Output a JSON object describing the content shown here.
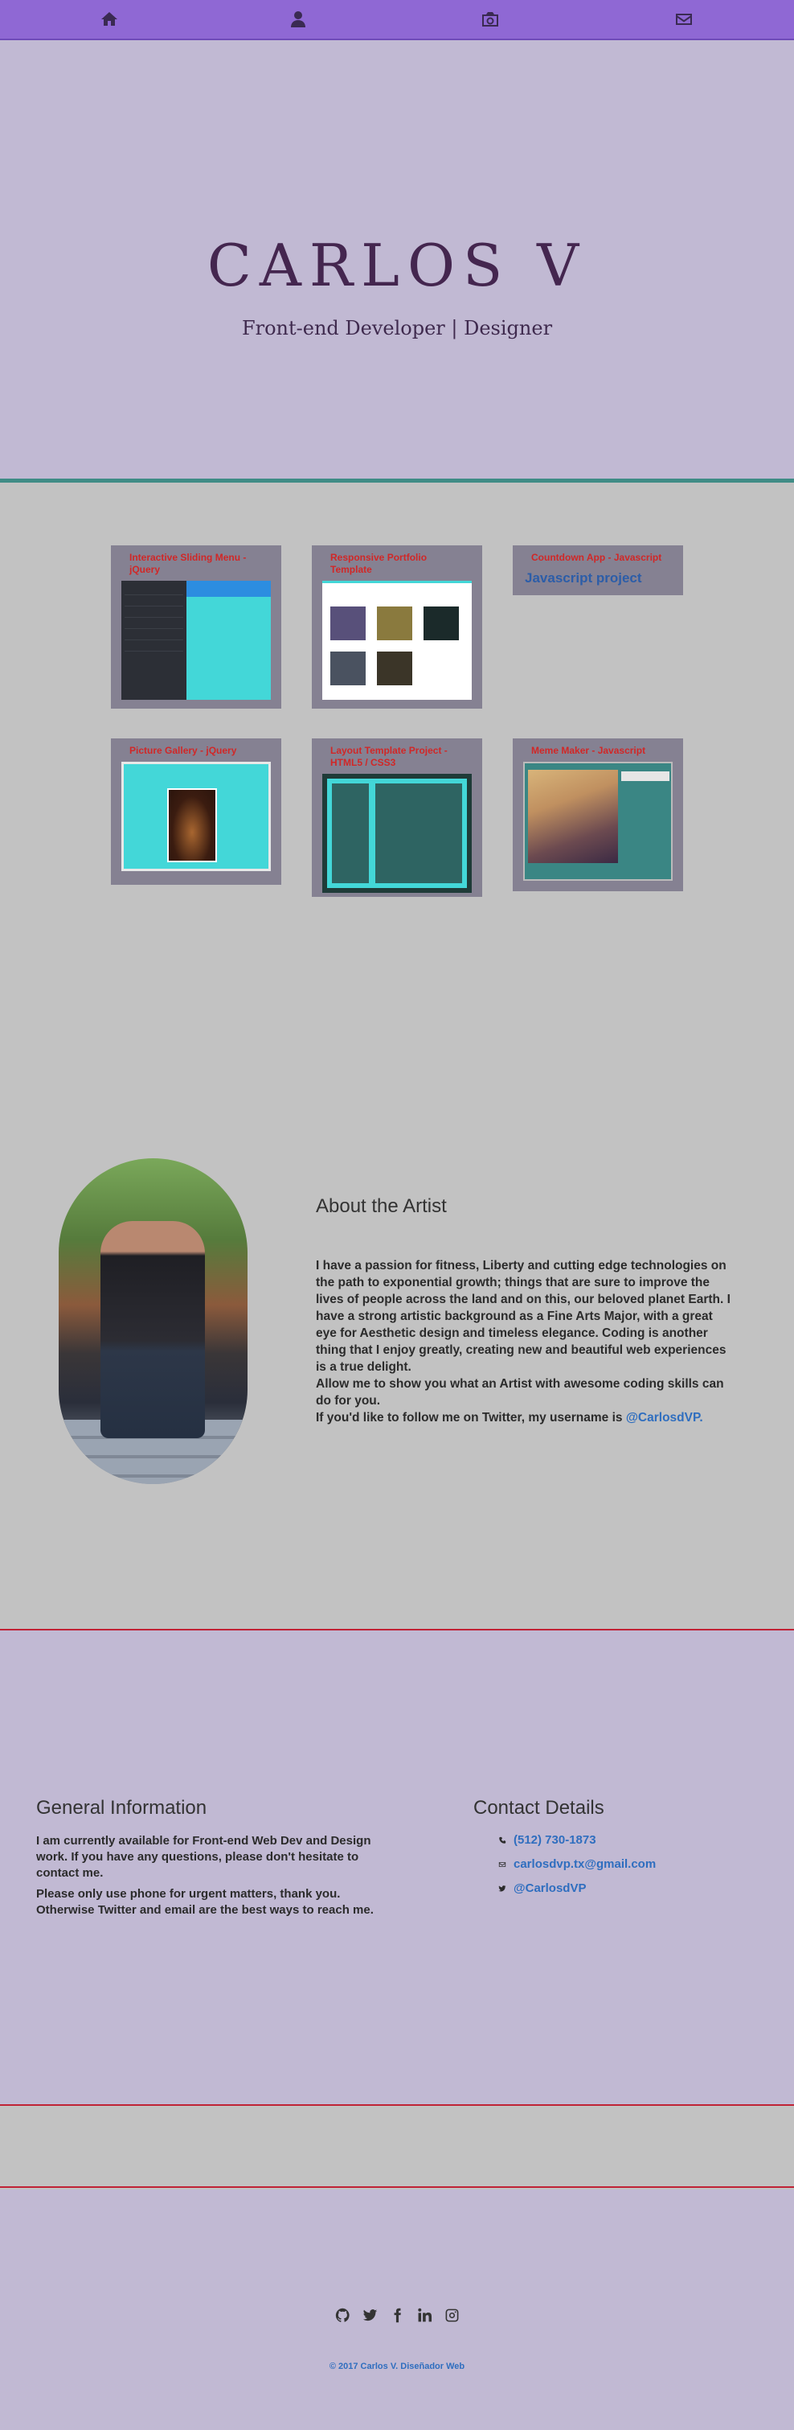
{
  "nav": {
    "items": [
      {
        "icon": "home-icon"
      },
      {
        "icon": "user-icon"
      },
      {
        "icon": "camera-icon"
      },
      {
        "icon": "envelope-icon"
      }
    ]
  },
  "hero": {
    "title": "CARLOS V",
    "subtitle": "Front-end Developer | Designer"
  },
  "portfolio": {
    "cards": [
      {
        "title": "Interactive Sliding Menu - jQuery"
      },
      {
        "title": "Responsive Portfolio Template"
      },
      {
        "title": "Countdown App - Javascript",
        "link": "Javascript project"
      },
      {
        "title": "Picture Gallery - jQuery"
      },
      {
        "title": "Layout Template Project - HTML5 / CSS3"
      },
      {
        "title": "Meme Maker - Javascript"
      }
    ]
  },
  "about": {
    "heading": "About the Artist",
    "text": "I have a passion for fitness, Liberty and cutting edge technologies on the path to exponential growth; things that are sure to improve the lives of people across the land and on this, our beloved planet Earth. I have a strong artistic background as a Fine Arts Major, with a great eye for Aesthetic design and timeless elegance. Coding is another thing that I enjoy greatly, creating new and beautiful web experiences is a true delight.",
    "text2": "Allow me to show you what an Artist with awesome coding skills can do for you.",
    "follow_prefix": "If you'd like to follow me on Twitter, my username is ",
    "twitter_handle": "@CarlosdVP."
  },
  "info": {
    "general_heading": "General Information",
    "general_p1": "I am currently available for Front-end Web Dev and Design work. If you have any questions, please don't hesitate to contact me.",
    "general_p2": "Please only use phone for urgent matters, thank you. Otherwise Twitter and email are the best ways to reach me.",
    "contact_heading": "Contact Details",
    "phone": "(512) 730-1873",
    "email": "carlosdvp.tx@gmail.com",
    "twitter": "@CarlosdVP"
  },
  "footer": {
    "social": [
      "github-icon",
      "twitter-icon",
      "facebook-icon",
      "linkedin-icon",
      "instagram-icon"
    ],
    "copyright": "© 2017 Carlos V. Diseñador Web"
  },
  "colors": {
    "nav": "#8f68d4",
    "hero_bg": "#c1b9d3",
    "title": "#44264f",
    "accent_teal": "#3f8c86",
    "card_title": "#d12727",
    "link": "#2f6ebf",
    "divider_red": "#c02235"
  }
}
